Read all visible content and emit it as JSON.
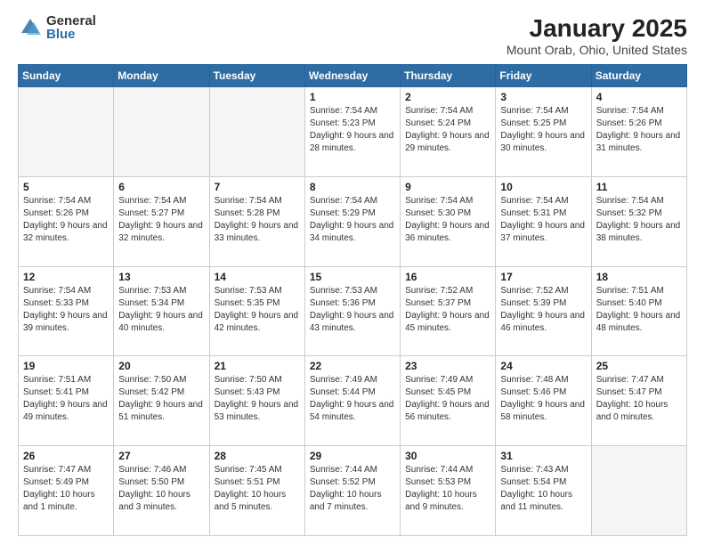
{
  "logo": {
    "general": "General",
    "blue": "Blue"
  },
  "header": {
    "title": "January 2025",
    "subtitle": "Mount Orab, Ohio, United States"
  },
  "weekdays": [
    "Sunday",
    "Monday",
    "Tuesday",
    "Wednesday",
    "Thursday",
    "Friday",
    "Saturday"
  ],
  "weeks": [
    [
      {
        "num": "",
        "info": ""
      },
      {
        "num": "",
        "info": ""
      },
      {
        "num": "",
        "info": ""
      },
      {
        "num": "1",
        "info": "Sunrise: 7:54 AM\nSunset: 5:23 PM\nDaylight: 9 hours\nand 28 minutes."
      },
      {
        "num": "2",
        "info": "Sunrise: 7:54 AM\nSunset: 5:24 PM\nDaylight: 9 hours\nand 29 minutes."
      },
      {
        "num": "3",
        "info": "Sunrise: 7:54 AM\nSunset: 5:25 PM\nDaylight: 9 hours\nand 30 minutes."
      },
      {
        "num": "4",
        "info": "Sunrise: 7:54 AM\nSunset: 5:26 PM\nDaylight: 9 hours\nand 31 minutes."
      }
    ],
    [
      {
        "num": "5",
        "info": "Sunrise: 7:54 AM\nSunset: 5:26 PM\nDaylight: 9 hours\nand 32 minutes."
      },
      {
        "num": "6",
        "info": "Sunrise: 7:54 AM\nSunset: 5:27 PM\nDaylight: 9 hours\nand 32 minutes."
      },
      {
        "num": "7",
        "info": "Sunrise: 7:54 AM\nSunset: 5:28 PM\nDaylight: 9 hours\nand 33 minutes."
      },
      {
        "num": "8",
        "info": "Sunrise: 7:54 AM\nSunset: 5:29 PM\nDaylight: 9 hours\nand 34 minutes."
      },
      {
        "num": "9",
        "info": "Sunrise: 7:54 AM\nSunset: 5:30 PM\nDaylight: 9 hours\nand 36 minutes."
      },
      {
        "num": "10",
        "info": "Sunrise: 7:54 AM\nSunset: 5:31 PM\nDaylight: 9 hours\nand 37 minutes."
      },
      {
        "num": "11",
        "info": "Sunrise: 7:54 AM\nSunset: 5:32 PM\nDaylight: 9 hours\nand 38 minutes."
      }
    ],
    [
      {
        "num": "12",
        "info": "Sunrise: 7:54 AM\nSunset: 5:33 PM\nDaylight: 9 hours\nand 39 minutes."
      },
      {
        "num": "13",
        "info": "Sunrise: 7:53 AM\nSunset: 5:34 PM\nDaylight: 9 hours\nand 40 minutes."
      },
      {
        "num": "14",
        "info": "Sunrise: 7:53 AM\nSunset: 5:35 PM\nDaylight: 9 hours\nand 42 minutes."
      },
      {
        "num": "15",
        "info": "Sunrise: 7:53 AM\nSunset: 5:36 PM\nDaylight: 9 hours\nand 43 minutes."
      },
      {
        "num": "16",
        "info": "Sunrise: 7:52 AM\nSunset: 5:37 PM\nDaylight: 9 hours\nand 45 minutes."
      },
      {
        "num": "17",
        "info": "Sunrise: 7:52 AM\nSunset: 5:39 PM\nDaylight: 9 hours\nand 46 minutes."
      },
      {
        "num": "18",
        "info": "Sunrise: 7:51 AM\nSunset: 5:40 PM\nDaylight: 9 hours\nand 48 minutes."
      }
    ],
    [
      {
        "num": "19",
        "info": "Sunrise: 7:51 AM\nSunset: 5:41 PM\nDaylight: 9 hours\nand 49 minutes."
      },
      {
        "num": "20",
        "info": "Sunrise: 7:50 AM\nSunset: 5:42 PM\nDaylight: 9 hours\nand 51 minutes."
      },
      {
        "num": "21",
        "info": "Sunrise: 7:50 AM\nSunset: 5:43 PM\nDaylight: 9 hours\nand 53 minutes."
      },
      {
        "num": "22",
        "info": "Sunrise: 7:49 AM\nSunset: 5:44 PM\nDaylight: 9 hours\nand 54 minutes."
      },
      {
        "num": "23",
        "info": "Sunrise: 7:49 AM\nSunset: 5:45 PM\nDaylight: 9 hours\nand 56 minutes."
      },
      {
        "num": "24",
        "info": "Sunrise: 7:48 AM\nSunset: 5:46 PM\nDaylight: 9 hours\nand 58 minutes."
      },
      {
        "num": "25",
        "info": "Sunrise: 7:47 AM\nSunset: 5:47 PM\nDaylight: 10 hours\nand 0 minutes."
      }
    ],
    [
      {
        "num": "26",
        "info": "Sunrise: 7:47 AM\nSunset: 5:49 PM\nDaylight: 10 hours\nand 1 minute."
      },
      {
        "num": "27",
        "info": "Sunrise: 7:46 AM\nSunset: 5:50 PM\nDaylight: 10 hours\nand 3 minutes."
      },
      {
        "num": "28",
        "info": "Sunrise: 7:45 AM\nSunset: 5:51 PM\nDaylight: 10 hours\nand 5 minutes."
      },
      {
        "num": "29",
        "info": "Sunrise: 7:44 AM\nSunset: 5:52 PM\nDaylight: 10 hours\nand 7 minutes."
      },
      {
        "num": "30",
        "info": "Sunrise: 7:44 AM\nSunset: 5:53 PM\nDaylight: 10 hours\nand 9 minutes."
      },
      {
        "num": "31",
        "info": "Sunrise: 7:43 AM\nSunset: 5:54 PM\nDaylight: 10 hours\nand 11 minutes."
      },
      {
        "num": "",
        "info": ""
      }
    ]
  ]
}
